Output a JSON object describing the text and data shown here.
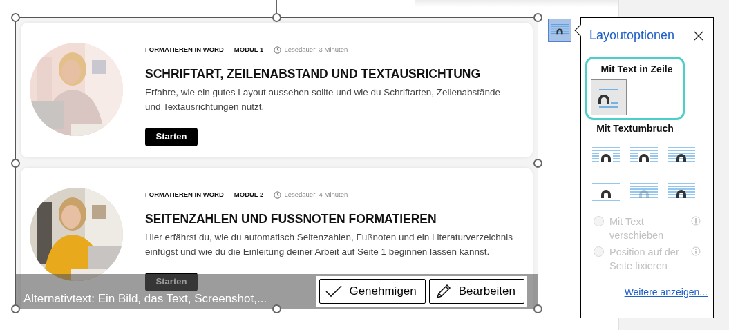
{
  "document": {
    "cards": [
      {
        "category": "FORMATIEREN IN WORD",
        "module": "MODUL 1",
        "reading_time": "Lesedauer: 3 Minuten",
        "title": "SCHRIFTART, ZEILENABSTAND UND TEXTAUSRICHTUNG",
        "description": "Erfahre, wie ein gutes Layout aussehen sollte und wie du Schriftarten, Zeilenabstände und Textausrichtungen nutzt.",
        "button": "Starten"
      },
      {
        "category": "FORMATIEREN IN WORD",
        "module": "MODUL 2",
        "reading_time": "Lesedauer: 4 Minuten",
        "title": "SEITENZAHLEN UND FUSSNOTEN FORMATIEREN",
        "description": "Hier erfährst du, wie du automatisch Seitenzahlen, Fußnoten und ein Literaturverzeichnis einfügst und wie du die Einleitung deiner Arbeit auf Seite 1 beginnen lassen kannst.",
        "button": "Starten"
      }
    ]
  },
  "alt_text_bar": {
    "text": "Alternativtext: Ein Bild, das Text, Screenshot,...",
    "buttons": [
      {
        "label": "Genehmigen",
        "kind": "approve"
      },
      {
        "label": "Bearbeiten",
        "kind": "edit"
      }
    ]
  },
  "layout_options": {
    "title": "Layoutoptionen",
    "inline_section": {
      "heading": "Mit Text in Zeile",
      "highlighted": true,
      "options": [
        {
          "kind": "inline",
          "selected": true
        }
      ]
    },
    "wrap_section": {
      "heading": "Mit Textumbruch",
      "options": [
        {
          "kind": "square",
          "selected": false
        },
        {
          "kind": "tight",
          "selected": false
        },
        {
          "kind": "through",
          "selected": false
        },
        {
          "kind": "top_bottom",
          "selected": false
        },
        {
          "kind": "behind",
          "selected": false
        },
        {
          "kind": "front",
          "selected": false
        }
      ]
    },
    "radios": [
      {
        "label": "Mit Text verschieben",
        "selected": false,
        "disabled": true
      },
      {
        "label": "Position auf der Seite fixieren",
        "selected": false,
        "disabled": true
      }
    ],
    "link": "Weitere anzeigen..."
  }
}
